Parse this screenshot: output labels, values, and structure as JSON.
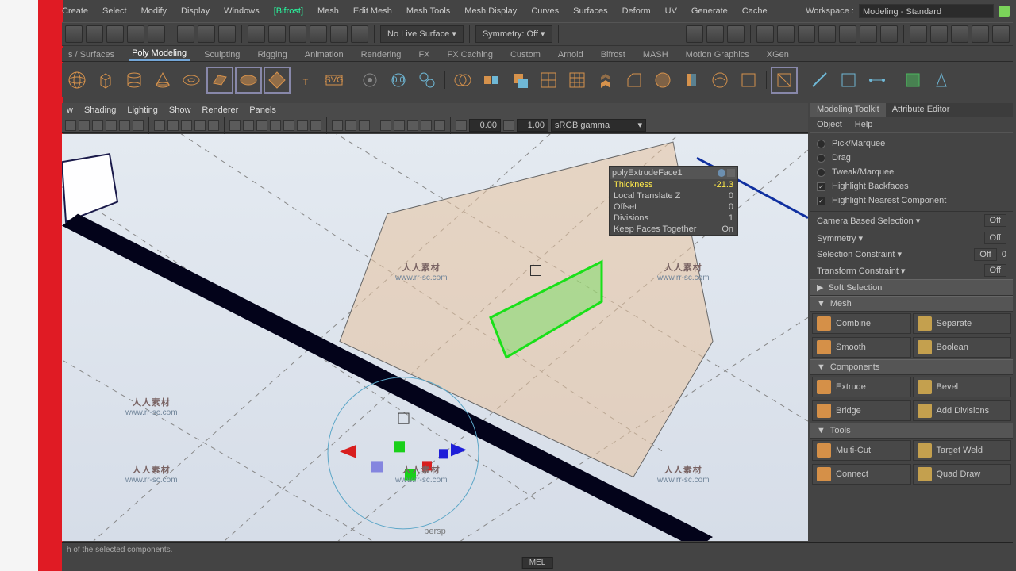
{
  "menus": [
    "Create",
    "Select",
    "Modify",
    "Display",
    "Windows",
    "[Bifrost]",
    "Mesh",
    "Edit Mesh",
    "Mesh Tools",
    "Mesh Display",
    "Curves",
    "Surfaces",
    "Deform",
    "UV",
    "Generate",
    "Cache"
  ],
  "workspace": {
    "label": "Workspace :",
    "value": "Modeling - Standard"
  },
  "shelfDrop1": "No Live Surface",
  "shelfDrop2": "Symmetry: Off",
  "shelfTabs": [
    "s / Surfaces",
    "Poly Modeling",
    "Sculpting",
    "Rigging",
    "Animation",
    "Rendering",
    "FX",
    "FX Caching",
    "Custom",
    "Arnold",
    "Bifrost",
    "MASH",
    "Motion Graphics",
    "XGen"
  ],
  "activeShelfTab": 1,
  "panelMenus": [
    "w",
    "Shading",
    "Lighting",
    "Show",
    "Renderer",
    "Panels"
  ],
  "num1": "0.00",
  "num2": "1.00",
  "gamma": "sRGB gamma",
  "hud": {
    "title": "polyExtrudeFace1",
    "rows": [
      {
        "k": "Thickness",
        "v": "-21.3",
        "hl": true
      },
      {
        "k": "Local Translate Z",
        "v": "0"
      },
      {
        "k": "Offset",
        "v": "0"
      },
      {
        "k": "Divisions",
        "v": "1"
      },
      {
        "k": "Keep Faces Together",
        "v": "On"
      }
    ]
  },
  "camlabel": "persp",
  "rpanel": {
    "tabs": [
      "Modeling Toolkit",
      "Attribute Editor"
    ],
    "menus": [
      "Object",
      "Help"
    ],
    "options": [
      "Pick/Marquee",
      "Drag",
      "Tweak/Marquee"
    ],
    "checks": [
      "Highlight Backfaces",
      "Highlight Nearest Component"
    ],
    "dds": [
      {
        "l": "Camera Based Selection",
        "v": "Off"
      },
      {
        "l": "Symmetry",
        "v": "Off"
      },
      {
        "l": "Selection Constraint",
        "v": "Off",
        "extra": "0"
      },
      {
        "l": "Transform Constraint",
        "v": "Off"
      }
    ],
    "soft": "Soft Selection",
    "mesh": {
      "title": "Mesh",
      "btns": [
        "Combine",
        "Separate",
        "Smooth",
        "Boolean"
      ]
    },
    "components": {
      "title": "Components",
      "btns": [
        "Extrude",
        "Bevel",
        "Bridge",
        "Add Divisions"
      ]
    },
    "tools": {
      "title": "Tools",
      "btns": [
        "Multi-Cut",
        "Target Weld",
        "Connect",
        "Quad Draw"
      ]
    }
  },
  "status": {
    "msg": "h of the selected components.",
    "mel": "MEL"
  },
  "watermark": {
    "cn": "人人素材",
    "url": "www.rr-sc.com"
  }
}
